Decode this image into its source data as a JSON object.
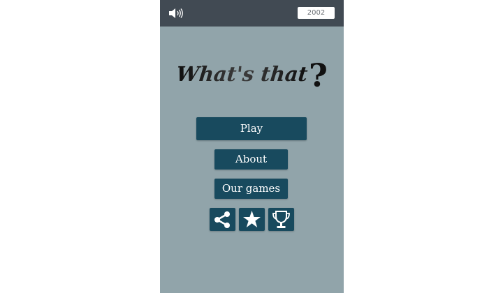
{
  "topbar": {
    "sound_icon": "speaker-icon",
    "score": "2002"
  },
  "logo": {
    "text": "What's that",
    "mark": "?"
  },
  "menu": {
    "play_label": "Play",
    "about_label": "About",
    "games_label": "Our games"
  },
  "icons": [
    "share-icon",
    "star-icon",
    "trophy-icon"
  ],
  "colors": {
    "background": "#91a4aa",
    "topbar": "#414a53",
    "button": "#184a5e",
    "button_text": "#ffffff"
  }
}
